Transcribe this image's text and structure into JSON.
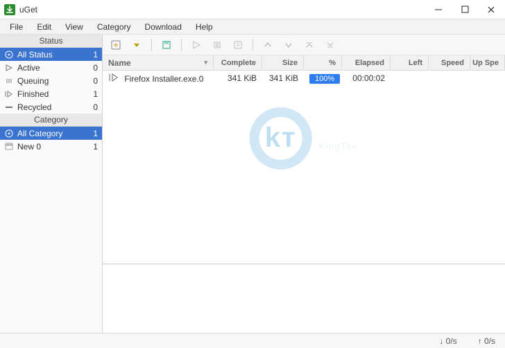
{
  "window": {
    "title": "uGet"
  },
  "menu": {
    "file": "File",
    "edit": "Edit",
    "view": "View",
    "category": "Category",
    "download": "Download",
    "help": "Help"
  },
  "sidebar": {
    "status_header": "Status",
    "category_header": "Category",
    "status": [
      {
        "label": "All Status",
        "count": "1"
      },
      {
        "label": "Active",
        "count": "0"
      },
      {
        "label": "Queuing",
        "count": "0"
      },
      {
        "label": "Finished",
        "count": "1"
      },
      {
        "label": "Recycled",
        "count": "0"
      }
    ],
    "categories": [
      {
        "label": "All Category",
        "count": "1"
      },
      {
        "label": "New 0",
        "count": "1"
      }
    ]
  },
  "columns": {
    "name": "Name",
    "complete": "Complete",
    "size": "Size",
    "pct": "%",
    "elapsed": "Elapsed",
    "left": "Left",
    "speed": "Speed",
    "upspe": "Up Spe"
  },
  "rows": [
    {
      "name": "Firefox Installer.exe.0",
      "complete": "341 KiB",
      "size": "341 KiB",
      "pct": "100%",
      "elapsed": "00:00:02",
      "left": "",
      "speed": "",
      "upspe": ""
    }
  ],
  "status": {
    "down": "↓ 0/s",
    "up": "↑ 0/s"
  },
  "watermark": "KingTec"
}
